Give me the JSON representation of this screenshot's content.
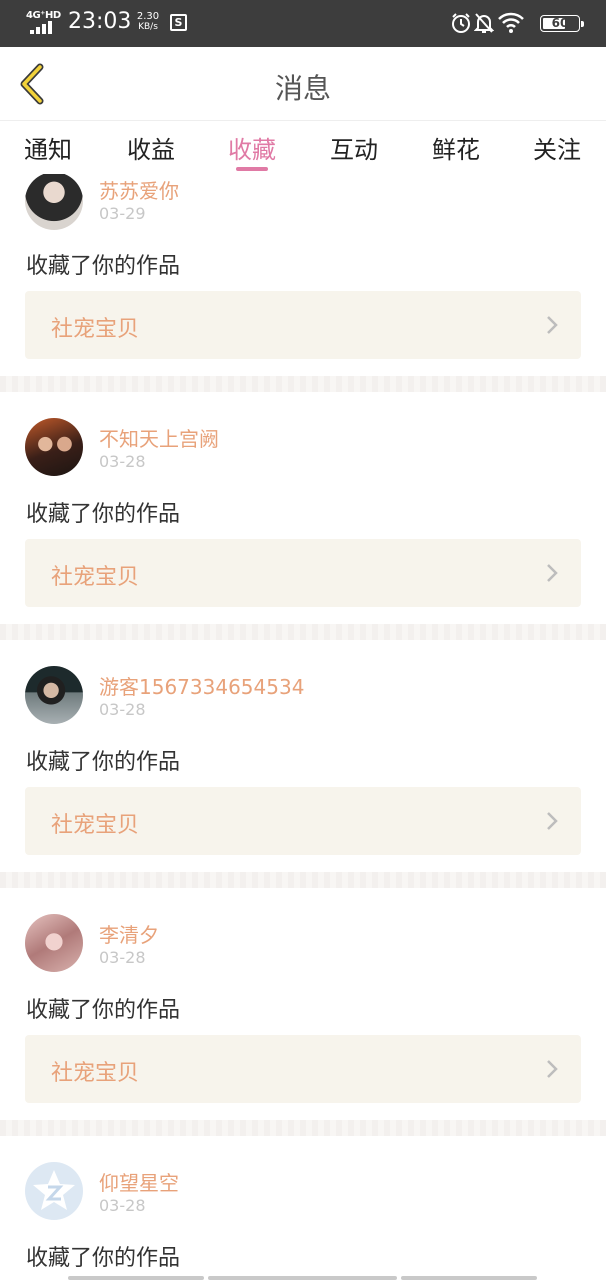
{
  "status_bar": {
    "network": "4G⁺HD",
    "time": "23:03",
    "speed_value": "2.30",
    "speed_unit": "KB/s",
    "app_icon_letter": "S",
    "battery": "60",
    "icons": [
      "signal-icon",
      "alarm-icon",
      "mute-notification-icon",
      "wifi-icon",
      "battery-icon"
    ]
  },
  "header": {
    "title": "消息",
    "back_icon": "chevron-left-icon"
  },
  "tabs": [
    {
      "label": "通知",
      "active": false
    },
    {
      "label": "收益",
      "active": false
    },
    {
      "label": "收藏",
      "active": true
    },
    {
      "label": "互动",
      "active": false
    },
    {
      "label": "鲜花",
      "active": false
    },
    {
      "label": "关注",
      "active": false
    }
  ],
  "colors": {
    "accent": "#e07aa5",
    "username": "#e8a27a",
    "work_box_bg": "#f7f4ec"
  },
  "messages": [
    {
      "username": "苏苏爱你",
      "date": "03-29",
      "action": "收藏了你的作品",
      "work": "社宠宝贝"
    },
    {
      "username": "不知天上宫阙",
      "date": "03-28",
      "action": "收藏了你的作品",
      "work": "社宠宝贝"
    },
    {
      "username": "游客1567334654534",
      "date": "03-28",
      "action": "收藏了你的作品",
      "work": "社宠宝贝"
    },
    {
      "username": "李清夕",
      "date": "03-28",
      "action": "收藏了你的作品",
      "work": "社宠宝贝"
    },
    {
      "username": "仰望星空",
      "date": "03-28",
      "action": "收藏了你的作品",
      "work": ""
    }
  ]
}
